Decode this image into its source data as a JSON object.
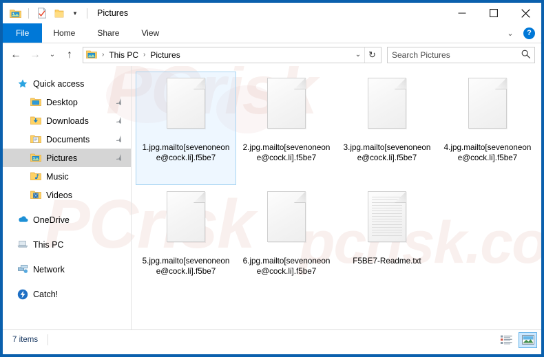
{
  "window": {
    "title": "Pictures",
    "quick_access_toolbar": [
      {
        "name": "pictures-folder-icon",
        "label": "Pictures"
      },
      {
        "name": "properties-icon",
        "label": "Properties"
      },
      {
        "name": "new-folder-icon",
        "label": "New folder"
      },
      {
        "name": "chevron-down-icon",
        "label": "Customize Quick Access Toolbar"
      }
    ],
    "controls": {
      "minimize": "—",
      "maximize": "☐",
      "close": "✕"
    }
  },
  "ribbon": {
    "tabs": [
      {
        "label": "File",
        "active": true
      },
      {
        "label": "Home",
        "active": false
      },
      {
        "label": "Share",
        "active": false
      },
      {
        "label": "View",
        "active": false
      }
    ],
    "expand_icon": "⌄",
    "help_label": "?"
  },
  "addressbar": {
    "back_icon": "←",
    "forward_icon": "→",
    "recent_icon": "⌄",
    "up_icon": "↑",
    "breadcrumb": [
      "This PC",
      "Pictures"
    ],
    "breadcrumb_separator": "›",
    "dropdown_icon": "⌄",
    "refresh_icon": "↻"
  },
  "search": {
    "placeholder": "Search Pictures",
    "value": "",
    "icon": "⚲"
  },
  "sidebar": {
    "items": [
      {
        "label": "Quick access",
        "icon": "star-icon",
        "indent": false,
        "pinned": false,
        "selected": false
      },
      {
        "label": "Desktop",
        "icon": "folder-desktop-icon",
        "indent": true,
        "pinned": true,
        "selected": false
      },
      {
        "label": "Downloads",
        "icon": "folder-downloads-icon",
        "indent": true,
        "pinned": true,
        "selected": false
      },
      {
        "label": "Documents",
        "icon": "folder-documents-icon",
        "indent": true,
        "pinned": true,
        "selected": false
      },
      {
        "label": "Pictures",
        "icon": "folder-pictures-icon",
        "indent": true,
        "pinned": true,
        "selected": true
      },
      {
        "label": "Music",
        "icon": "folder-music-icon",
        "indent": true,
        "pinned": false,
        "selected": false
      },
      {
        "label": "Videos",
        "icon": "folder-videos-icon",
        "indent": true,
        "pinned": false,
        "selected": false
      },
      {
        "label": "OneDrive",
        "icon": "onedrive-cloud-icon",
        "indent": false,
        "pinned": false,
        "selected": false,
        "gap_before": true
      },
      {
        "label": "This PC",
        "icon": "this-pc-icon",
        "indent": false,
        "pinned": false,
        "selected": false,
        "gap_before": true
      },
      {
        "label": "Network",
        "icon": "network-icon",
        "indent": false,
        "pinned": false,
        "selected": false,
        "gap_before": true
      },
      {
        "label": "Catch!",
        "icon": "catch-icon",
        "indent": false,
        "pinned": false,
        "selected": false,
        "gap_before": true
      }
    ],
    "pin_icon": "📌"
  },
  "files": [
    {
      "name": "1.jpg.mailto[sevenoneone@cock.li].f5be7",
      "type": "blank",
      "selected": true
    },
    {
      "name": "2.jpg.mailto[sevenoneone@cock.li].f5be7",
      "type": "blank",
      "selected": false
    },
    {
      "name": "3.jpg.mailto[sevenoneone@cock.li].f5be7",
      "type": "blank",
      "selected": false
    },
    {
      "name": "4.jpg.mailto[sevenoneone@cock.li].f5be7",
      "type": "blank",
      "selected": false
    },
    {
      "name": "5.jpg.mailto[sevenoneone@cock.li].f5be7",
      "type": "blank",
      "selected": false
    },
    {
      "name": "6.jpg.mailto[sevenoneone@cock.li].f5be7",
      "type": "blank",
      "selected": false
    },
    {
      "name": "F5BE7-Readme.txt",
      "type": "text",
      "selected": false
    }
  ],
  "statusbar": {
    "item_count": "7 items",
    "views": [
      {
        "name": "details-view-button",
        "active": false
      },
      {
        "name": "large-icons-view-button",
        "active": true
      }
    ]
  },
  "watermark": {
    "line1": "PCrisk",
    "line2": "PCrisk",
    "line3": "pcrisk.com"
  },
  "colors": {
    "window_border": "#0a60ad",
    "file_tab": "#0078d7",
    "selection": "#cce8ff",
    "selection_border": "#a8d4f2",
    "sidebar_selected": "#d5d5d5",
    "status_text": "#1b3a63"
  }
}
